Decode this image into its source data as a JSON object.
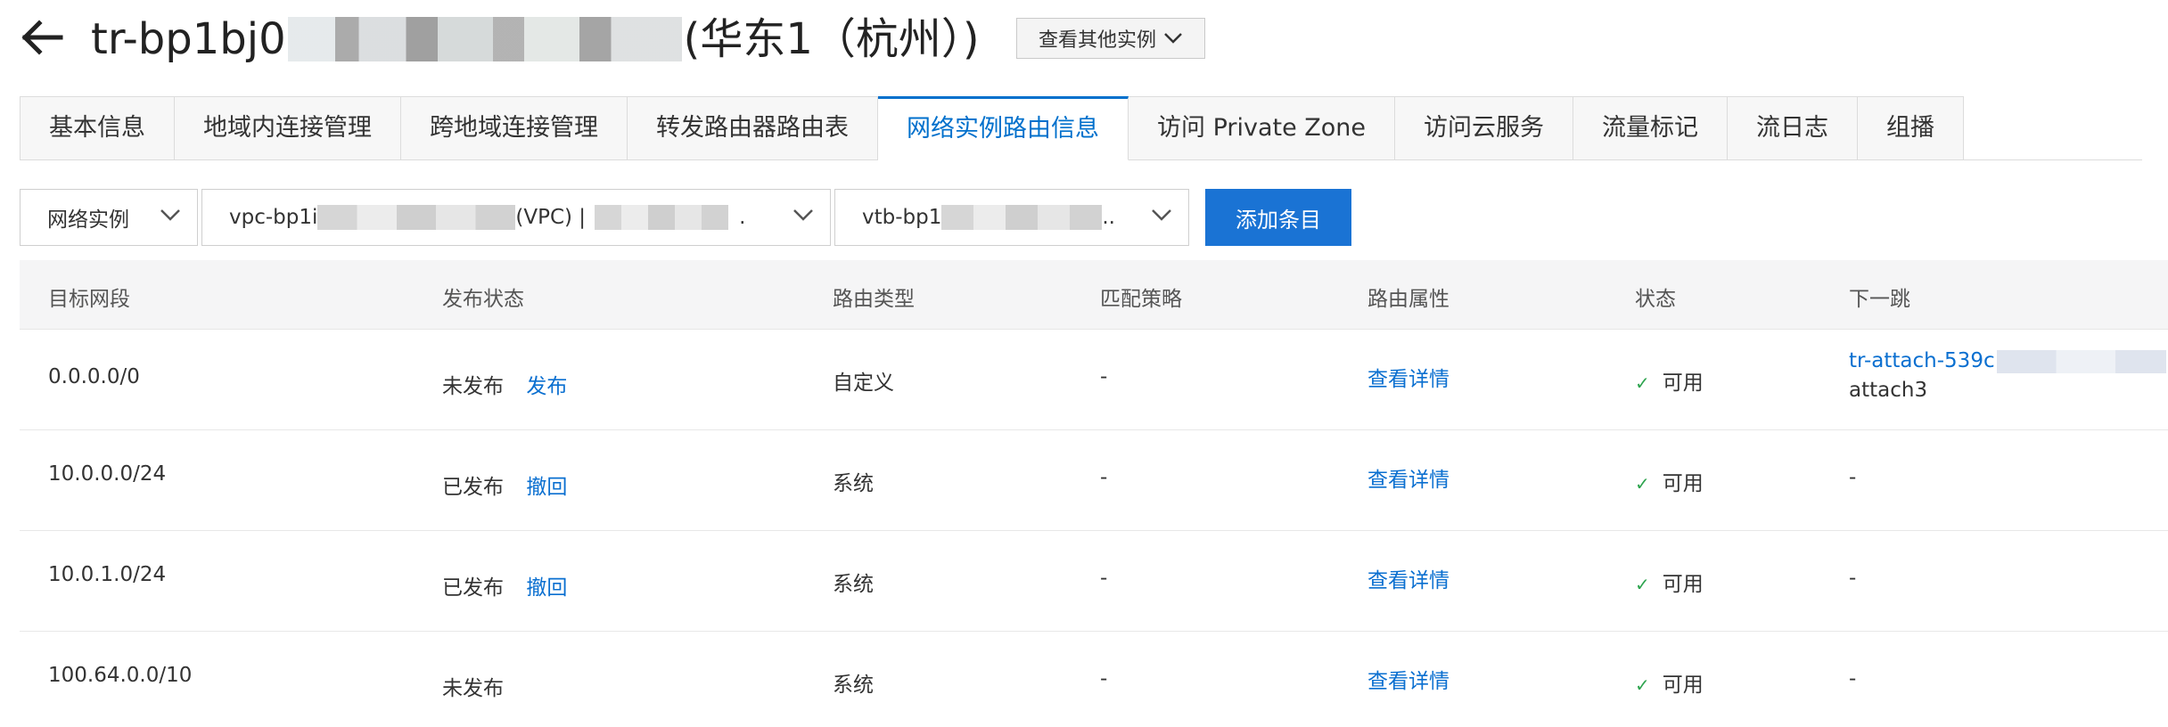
{
  "header": {
    "title_prefix": "tr-bp1bj0",
    "title_suffix": "(华东1（杭州）)",
    "other_instances_label": "查看其他实例"
  },
  "tabs": [
    {
      "label": "基本信息",
      "active": false
    },
    {
      "label": "地域内连接管理",
      "active": false
    },
    {
      "label": "跨地域连接管理",
      "active": false
    },
    {
      "label": "转发路由器路由表",
      "active": false
    },
    {
      "label": "网络实例路由信息",
      "active": true
    },
    {
      "label": "访问 Private Zone",
      "active": false
    },
    {
      "label": "访问云服务",
      "active": false
    },
    {
      "label": "流量标记",
      "active": false
    },
    {
      "label": "流日志",
      "active": false
    },
    {
      "label": "组播",
      "active": false
    }
  ],
  "filters": {
    "instance_type": "网络实例",
    "vpc_prefix": "vpc-bp1i",
    "vpc_mid": "(VPC) |",
    "vpc_suffix": ".",
    "vtb_prefix": "vtb-bp1",
    "vtb_suffix": "..",
    "add_label": "添加条目"
  },
  "table": {
    "columns": [
      "目标网段",
      "发布状态",
      "路由类型",
      "匹配策略",
      "路由属性",
      "状态",
      "下一跳"
    ],
    "rows": [
      {
        "cidr": "0.0.0.0/0",
        "publish_status": "未发布",
        "publish_action": "发布",
        "route_type": "自定义",
        "policy": "-",
        "attr": "查看详情",
        "status": "可用",
        "next_hop_link": "tr-attach-539c",
        "next_hop_sub": "attach3"
      },
      {
        "cidr": "10.0.0.0/24",
        "publish_status": "已发布",
        "publish_action": "撤回",
        "route_type": "系统",
        "policy": "-",
        "attr": "查看详情",
        "status": "可用",
        "next_hop": "-"
      },
      {
        "cidr": "10.0.1.0/24",
        "publish_status": "已发布",
        "publish_action": "撤回",
        "route_type": "系统",
        "policy": "-",
        "attr": "查看详情",
        "status": "可用",
        "next_hop": "-"
      },
      {
        "cidr": "100.64.0.0/10",
        "publish_status": "未发布",
        "publish_action": "",
        "route_type": "系统",
        "policy": "-",
        "attr": "查看详情",
        "status": "可用",
        "next_hop": "-"
      }
    ]
  },
  "icons": {
    "back": "arrow-left-icon",
    "chevron": "chevron-down-icon",
    "check": "check-icon"
  },
  "colors": {
    "accent": "#0070cc",
    "button": "#1a73d4",
    "success": "#2ea44f"
  }
}
